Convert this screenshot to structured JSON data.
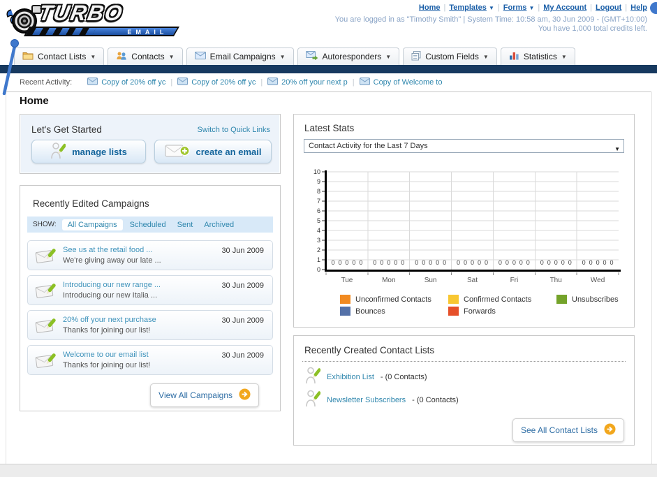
{
  "header": {
    "logo": {
      "title": "TURBO",
      "subtitle": "EMAIL"
    },
    "nav": [
      {
        "label": "Home",
        "dropdown": false
      },
      {
        "label": "Templates",
        "dropdown": true
      },
      {
        "label": "Forms",
        "dropdown": true
      },
      {
        "label": "My Account",
        "dropdown": false
      },
      {
        "label": "Logout",
        "dropdown": false
      },
      {
        "label": "Help",
        "dropdown": false
      }
    ],
    "login_info": "You are logged in as \"Timothy Smith\" | System Time: 10:58 am, 30 Jun 2009 - (GMT+10:00)",
    "credits_info": "You have 1,000 total credits left."
  },
  "tabs": [
    {
      "label": "Contact Lists",
      "icon": "folder-icon"
    },
    {
      "label": "Contacts",
      "icon": "contacts-icon"
    },
    {
      "label": "Email Campaigns",
      "icon": "envelope-icon"
    },
    {
      "label": "Autoresponders",
      "icon": "envelope-forward-icon"
    },
    {
      "label": "Custom Fields",
      "icon": "pages-icon"
    },
    {
      "label": "Statistics",
      "icon": "bar-chart-icon"
    }
  ],
  "recent_activity": {
    "label": "Recent Activity:",
    "items": [
      "Copy of 20% off yc",
      "Copy of 20% off yc",
      "20% off your next p",
      "Copy of Welcome to"
    ]
  },
  "page_title": "Home",
  "get_started": {
    "title": "Let's Get Started",
    "switch_link": "Switch to Quick Links",
    "buttons": [
      {
        "label": "manage lists",
        "icon": "person-pencil-icon"
      },
      {
        "label": "create an email",
        "icon": "envelope-plus-icon"
      }
    ]
  },
  "campaigns": {
    "title": "Recently Edited Campaigns",
    "show_label": "SHOW:",
    "filters": [
      "All Campaigns",
      "Scheduled",
      "Sent",
      "Archived"
    ],
    "active_filter": "All Campaigns",
    "items": [
      {
        "title": "See us at the retail food ...",
        "subtitle": "We're giving away our late ...",
        "date": "30 Jun 2009"
      },
      {
        "title": "Introducing our new range ...",
        "subtitle": "Introducing our new Italia ...",
        "date": "30 Jun 2009"
      },
      {
        "title": "20% off your next purchase",
        "subtitle": "Thanks for joining our list!",
        "date": "30 Jun 2009"
      },
      {
        "title": "Welcome to our email list",
        "subtitle": "Thanks for joining our list!",
        "date": "30 Jun 2009"
      }
    ],
    "view_all_label": "View All Campaigns"
  },
  "stats": {
    "title": "Latest Stats",
    "dropdown_value": "Contact Activity for the Last 7 Days"
  },
  "chart_data": {
    "type": "bar",
    "title": "Contact Activity for the Last 7 Days",
    "categories": [
      "Tue",
      "Mon",
      "Sun",
      "Sat",
      "Fri",
      "Thu",
      "Wed"
    ],
    "series": [
      {
        "name": "Unconfirmed Contacts",
        "color": "#f18a21",
        "values": [
          0,
          0,
          0,
          0,
          0,
          0,
          0
        ]
      },
      {
        "name": "Confirmed Contacts",
        "color": "#f8c732",
        "values": [
          0,
          0,
          0,
          0,
          0,
          0,
          0
        ]
      },
      {
        "name": "Unsubscribes",
        "color": "#74a32a",
        "values": [
          0,
          0,
          0,
          0,
          0,
          0,
          0
        ]
      },
      {
        "name": "Bounces",
        "color": "#5471a8",
        "values": [
          0,
          0,
          0,
          0,
          0,
          0,
          0
        ]
      },
      {
        "name": "Forwards",
        "color": "#e6502a",
        "values": [
          0,
          0,
          0,
          0,
          0,
          0,
          0
        ]
      }
    ],
    "ylim": [
      0,
      10
    ],
    "ytick_step": 1,
    "grid": true,
    "legend_position": "bottom",
    "data_labels_shown": true
  },
  "contact_lists": {
    "title": "Recently Created Contact Lists",
    "items": [
      {
        "name": "Exhibition List",
        "count_text": "(0 Contacts)"
      },
      {
        "name": "Newsletter Subscribers",
        "count_text": "(0 Contacts)"
      }
    ],
    "see_all_label": "See All Contact Lists"
  },
  "colors": {
    "navy_bar": "#17395f",
    "link_blue": "#1b5fa8",
    "teal_link": "#2e86ad",
    "accent_orange": "#f2a71d",
    "logo_blue": "#2f6fd0"
  }
}
